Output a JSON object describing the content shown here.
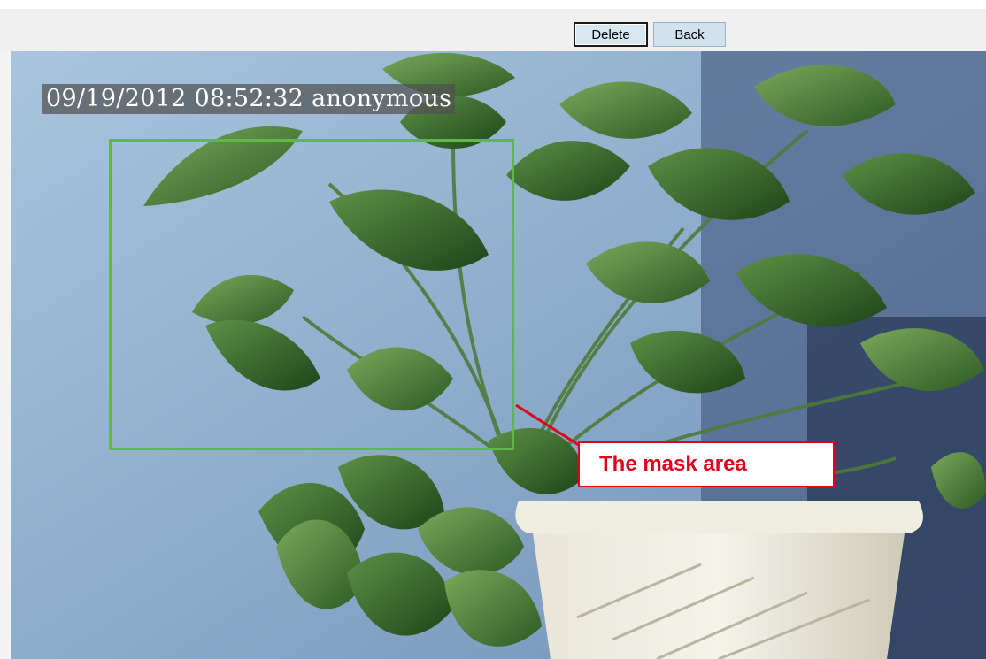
{
  "toolbar": {
    "delete_label": "Delete",
    "back_label": "Back"
  },
  "camera_view": {
    "osd_timestamp": "09/19/2012 08:52:32 anonymous",
    "mask_area_color": "#5fb84a"
  },
  "annotation": {
    "callout_text": "The mask area",
    "callout_color": "#e0001b"
  }
}
